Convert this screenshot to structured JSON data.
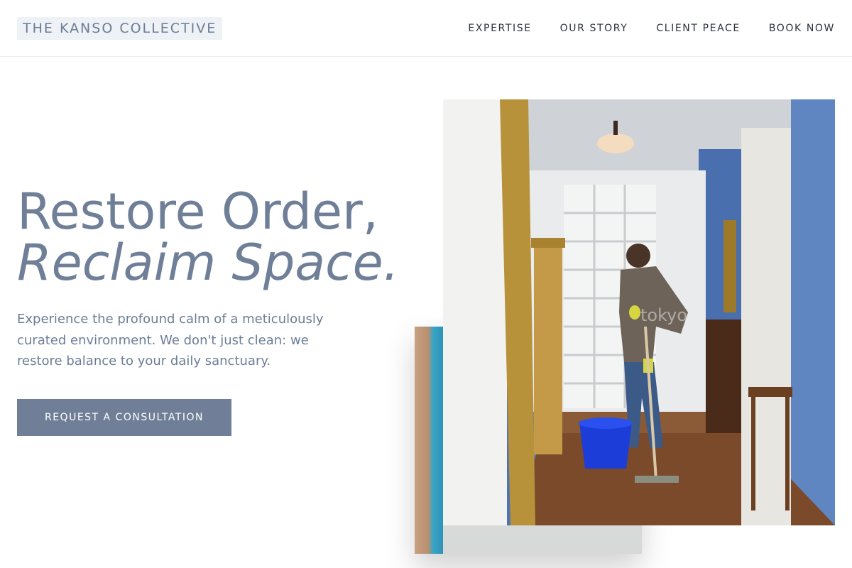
{
  "header": {
    "logo": "THE KANSO COLLECTIVE",
    "nav": [
      {
        "label": "EXPERTISE"
      },
      {
        "label": "OUR STORY"
      },
      {
        "label": "CLIENT PEACE"
      },
      {
        "label": "BOOK NOW"
      }
    ]
  },
  "hero": {
    "title_line1": "Restore Order,",
    "title_line2": "Reclaim Space.",
    "description": "Experience the profound calm of a meticulously curated environment. We don't just clean: we restore balance to your daily sanctuary.",
    "cta_label": "REQUEST A CONSULTATION"
  },
  "photo_front": {
    "watermark": "tokyo"
  },
  "colors": {
    "accent": "#707f97",
    "text": "#6b7d96",
    "nav_text": "#2c3440",
    "logo_bg": "#eef1f5"
  }
}
